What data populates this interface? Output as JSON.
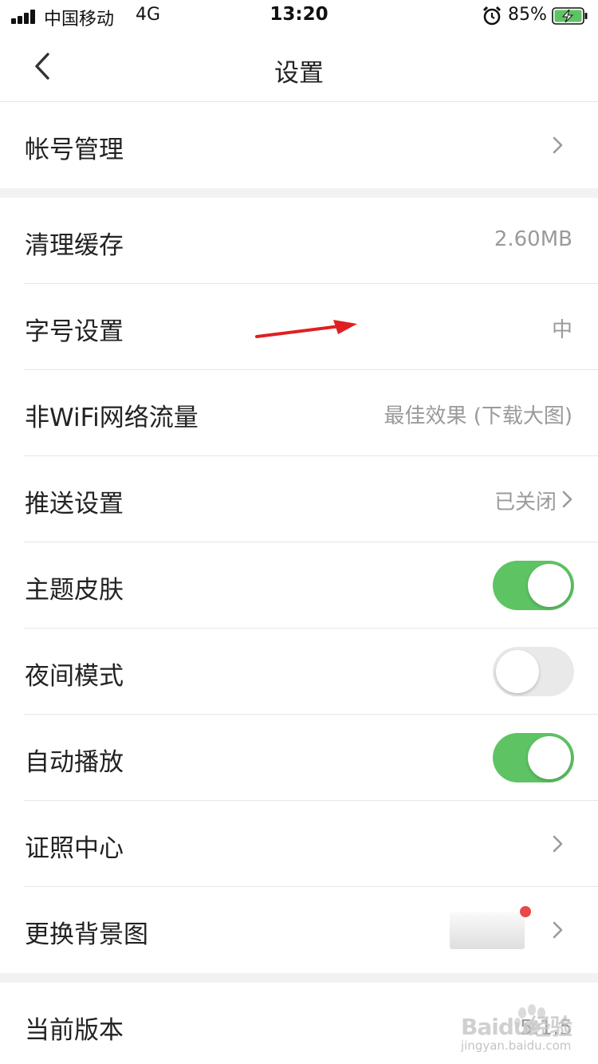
{
  "status_bar": {
    "carrier": "中国移动",
    "network": "4G",
    "time": "13:20",
    "battery_percent": "85%",
    "battery_color": "#5ec363",
    "icons": [
      "signal-icon",
      "alarm-icon",
      "battery-charging-icon"
    ]
  },
  "nav": {
    "title": "设置",
    "back_icon": "chevron-left-icon"
  },
  "rows": {
    "account": {
      "label": "帐号管理"
    },
    "cache": {
      "label": "清理缓存",
      "value": "2.60MB"
    },
    "font_size": {
      "label": "字号设置",
      "value": "中"
    },
    "non_wifi": {
      "label": "非WiFi网络流量",
      "value": "最佳效果 (下载大图)"
    },
    "push": {
      "label": "推送设置",
      "value": "已关闭"
    },
    "theme": {
      "label": "主题皮肤",
      "toggle": "on"
    },
    "night": {
      "label": "夜间模式",
      "toggle": "off"
    },
    "autoplay": {
      "label": "自动播放",
      "toggle": "on"
    },
    "license": {
      "label": "证照中心"
    },
    "background": {
      "label": "更换背景图"
    },
    "version": {
      "label": "当前版本",
      "value": "5.1.5"
    }
  },
  "colors": {
    "toggle_on": "#5ec363",
    "toggle_off": "#e9e9ea",
    "annotation_arrow": "#e02020",
    "notification_dot": "#e84848"
  },
  "watermark": {
    "brand": "Baidu经验",
    "url": "jingyan.baidu.com"
  }
}
